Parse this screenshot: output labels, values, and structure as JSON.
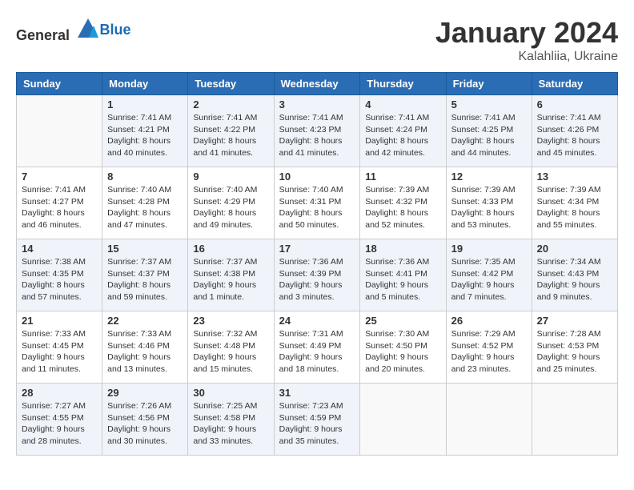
{
  "header": {
    "logo_general": "General",
    "logo_blue": "Blue",
    "month": "January 2024",
    "location": "Kalahliia, Ukraine"
  },
  "weekdays": [
    "Sunday",
    "Monday",
    "Tuesday",
    "Wednesday",
    "Thursday",
    "Friday",
    "Saturday"
  ],
  "weeks": [
    [
      {
        "day": "",
        "sunrise": "",
        "sunset": "",
        "daylight": ""
      },
      {
        "day": "1",
        "sunrise": "Sunrise: 7:41 AM",
        "sunset": "Sunset: 4:21 PM",
        "daylight": "Daylight: 8 hours and 40 minutes."
      },
      {
        "day": "2",
        "sunrise": "Sunrise: 7:41 AM",
        "sunset": "Sunset: 4:22 PM",
        "daylight": "Daylight: 8 hours and 41 minutes."
      },
      {
        "day": "3",
        "sunrise": "Sunrise: 7:41 AM",
        "sunset": "Sunset: 4:23 PM",
        "daylight": "Daylight: 8 hours and 41 minutes."
      },
      {
        "day": "4",
        "sunrise": "Sunrise: 7:41 AM",
        "sunset": "Sunset: 4:24 PM",
        "daylight": "Daylight: 8 hours and 42 minutes."
      },
      {
        "day": "5",
        "sunrise": "Sunrise: 7:41 AM",
        "sunset": "Sunset: 4:25 PM",
        "daylight": "Daylight: 8 hours and 44 minutes."
      },
      {
        "day": "6",
        "sunrise": "Sunrise: 7:41 AM",
        "sunset": "Sunset: 4:26 PM",
        "daylight": "Daylight: 8 hours and 45 minutes."
      }
    ],
    [
      {
        "day": "7",
        "sunrise": "Sunrise: 7:41 AM",
        "sunset": "Sunset: 4:27 PM",
        "daylight": "Daylight: 8 hours and 46 minutes."
      },
      {
        "day": "8",
        "sunrise": "Sunrise: 7:40 AM",
        "sunset": "Sunset: 4:28 PM",
        "daylight": "Daylight: 8 hours and 47 minutes."
      },
      {
        "day": "9",
        "sunrise": "Sunrise: 7:40 AM",
        "sunset": "Sunset: 4:29 PM",
        "daylight": "Daylight: 8 hours and 49 minutes."
      },
      {
        "day": "10",
        "sunrise": "Sunrise: 7:40 AM",
        "sunset": "Sunset: 4:31 PM",
        "daylight": "Daylight: 8 hours and 50 minutes."
      },
      {
        "day": "11",
        "sunrise": "Sunrise: 7:39 AM",
        "sunset": "Sunset: 4:32 PM",
        "daylight": "Daylight: 8 hours and 52 minutes."
      },
      {
        "day": "12",
        "sunrise": "Sunrise: 7:39 AM",
        "sunset": "Sunset: 4:33 PM",
        "daylight": "Daylight: 8 hours and 53 minutes."
      },
      {
        "day": "13",
        "sunrise": "Sunrise: 7:39 AM",
        "sunset": "Sunset: 4:34 PM",
        "daylight": "Daylight: 8 hours and 55 minutes."
      }
    ],
    [
      {
        "day": "14",
        "sunrise": "Sunrise: 7:38 AM",
        "sunset": "Sunset: 4:35 PM",
        "daylight": "Daylight: 8 hours and 57 minutes."
      },
      {
        "day": "15",
        "sunrise": "Sunrise: 7:37 AM",
        "sunset": "Sunset: 4:37 PM",
        "daylight": "Daylight: 8 hours and 59 minutes."
      },
      {
        "day": "16",
        "sunrise": "Sunrise: 7:37 AM",
        "sunset": "Sunset: 4:38 PM",
        "daylight": "Daylight: 9 hours and 1 minute."
      },
      {
        "day": "17",
        "sunrise": "Sunrise: 7:36 AM",
        "sunset": "Sunset: 4:39 PM",
        "daylight": "Daylight: 9 hours and 3 minutes."
      },
      {
        "day": "18",
        "sunrise": "Sunrise: 7:36 AM",
        "sunset": "Sunset: 4:41 PM",
        "daylight": "Daylight: 9 hours and 5 minutes."
      },
      {
        "day": "19",
        "sunrise": "Sunrise: 7:35 AM",
        "sunset": "Sunset: 4:42 PM",
        "daylight": "Daylight: 9 hours and 7 minutes."
      },
      {
        "day": "20",
        "sunrise": "Sunrise: 7:34 AM",
        "sunset": "Sunset: 4:43 PM",
        "daylight": "Daylight: 9 hours and 9 minutes."
      }
    ],
    [
      {
        "day": "21",
        "sunrise": "Sunrise: 7:33 AM",
        "sunset": "Sunset: 4:45 PM",
        "daylight": "Daylight: 9 hours and 11 minutes."
      },
      {
        "day": "22",
        "sunrise": "Sunrise: 7:33 AM",
        "sunset": "Sunset: 4:46 PM",
        "daylight": "Daylight: 9 hours and 13 minutes."
      },
      {
        "day": "23",
        "sunrise": "Sunrise: 7:32 AM",
        "sunset": "Sunset: 4:48 PM",
        "daylight": "Daylight: 9 hours and 15 minutes."
      },
      {
        "day": "24",
        "sunrise": "Sunrise: 7:31 AM",
        "sunset": "Sunset: 4:49 PM",
        "daylight": "Daylight: 9 hours and 18 minutes."
      },
      {
        "day": "25",
        "sunrise": "Sunrise: 7:30 AM",
        "sunset": "Sunset: 4:50 PM",
        "daylight": "Daylight: 9 hours and 20 minutes."
      },
      {
        "day": "26",
        "sunrise": "Sunrise: 7:29 AM",
        "sunset": "Sunset: 4:52 PM",
        "daylight": "Daylight: 9 hours and 23 minutes."
      },
      {
        "day": "27",
        "sunrise": "Sunrise: 7:28 AM",
        "sunset": "Sunset: 4:53 PM",
        "daylight": "Daylight: 9 hours and 25 minutes."
      }
    ],
    [
      {
        "day": "28",
        "sunrise": "Sunrise: 7:27 AM",
        "sunset": "Sunset: 4:55 PM",
        "daylight": "Daylight: 9 hours and 28 minutes."
      },
      {
        "day": "29",
        "sunrise": "Sunrise: 7:26 AM",
        "sunset": "Sunset: 4:56 PM",
        "daylight": "Daylight: 9 hours and 30 minutes."
      },
      {
        "day": "30",
        "sunrise": "Sunrise: 7:25 AM",
        "sunset": "Sunset: 4:58 PM",
        "daylight": "Daylight: 9 hours and 33 minutes."
      },
      {
        "day": "31",
        "sunrise": "Sunrise: 7:23 AM",
        "sunset": "Sunset: 4:59 PM",
        "daylight": "Daylight: 9 hours and 35 minutes."
      },
      {
        "day": "",
        "sunrise": "",
        "sunset": "",
        "daylight": ""
      },
      {
        "day": "",
        "sunrise": "",
        "sunset": "",
        "daylight": ""
      },
      {
        "day": "",
        "sunrise": "",
        "sunset": "",
        "daylight": ""
      }
    ]
  ]
}
